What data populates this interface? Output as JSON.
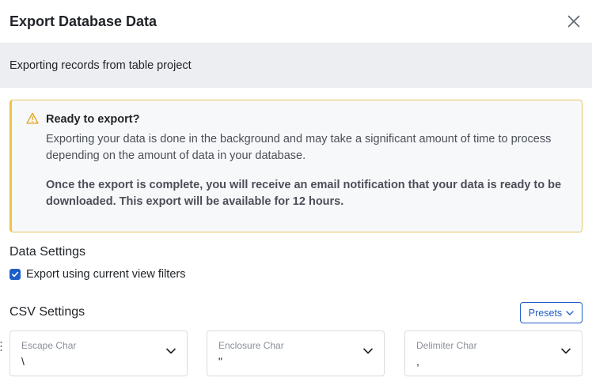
{
  "dialog": {
    "title": "Export Database Data",
    "subtitle": "Exporting records from table project"
  },
  "alert": {
    "title": "Ready to export?",
    "body": "Exporting your data is done in the background and may take a significant amount of time to process depending on the amount of data in your database.",
    "bold": "Once the export is complete, you will receive an email notification that your data is ready to be downloaded. This export will be available for 12 hours.",
    "color": "#f0c24b"
  },
  "data_settings": {
    "title": "Data Settings",
    "checkbox_label": "Export using current view filters",
    "checked": true
  },
  "csv_settings": {
    "title": "CSV Settings",
    "presets_label": "Presets",
    "fields": [
      {
        "label": "Escape Char",
        "value": "\\"
      },
      {
        "label": "Enclosure Char",
        "value": "\""
      },
      {
        "label": "Delimiter Char",
        "value": ","
      }
    ]
  },
  "colors": {
    "accent": "#1d5ec7",
    "subheader_bg": "#eceef1"
  }
}
